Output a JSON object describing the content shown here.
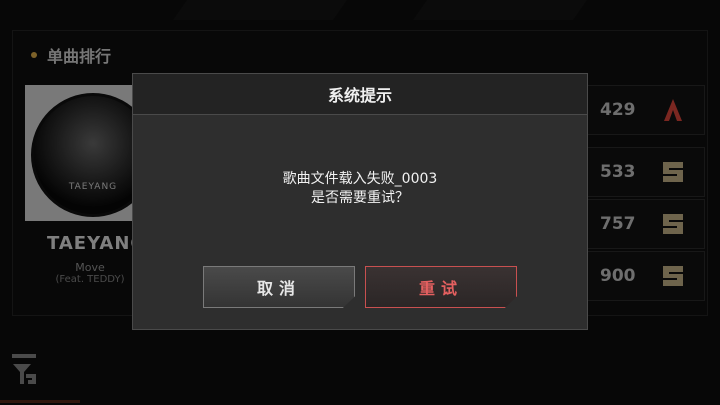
{
  "panel": {
    "title": "单曲排行"
  },
  "album": {
    "disc_text": "TAEYANG",
    "artist": "TAEYANG",
    "song": "Move",
    "feat": "(Feat. TEDDY)"
  },
  "scores": [
    {
      "value": "429",
      "grade_icon": "grade-a-icon",
      "grade_color": "#e0483c"
    },
    {
      "value": "533",
      "grade_icon": "grade-s-icon",
      "grade_color": "#c9b68a"
    },
    {
      "value": "757",
      "grade_icon": "grade-s-icon",
      "grade_color": "#c9b68a"
    },
    {
      "value": "900",
      "grade_icon": "grade-s-icon",
      "grade_color": "#c9b68a"
    }
  ],
  "dialog": {
    "title": "系统提示",
    "message_line1": "歌曲文件载入失败_0003",
    "message_line2": "是否需要重试？",
    "cancel_label": "取消",
    "retry_label": "重试"
  },
  "colors": {
    "accent_red": "#e56060",
    "accent_gold": "#e3b34c"
  }
}
